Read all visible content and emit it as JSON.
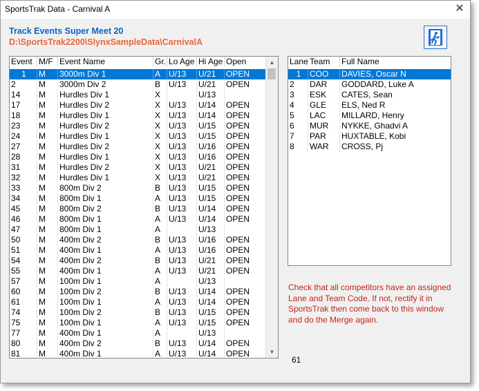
{
  "window": {
    "title": "SportsTrak Data - Carnival A",
    "close_glyph": "✕"
  },
  "header": {
    "title": "Track Events  Super Meet 20",
    "path": "D:\\SportsTrak2200\\SlynxSampleData\\CarnivalA",
    "title_color": "#0a64c8",
    "path_color": "#e8663c"
  },
  "run_button": {
    "icon": "running-man-exit-icon"
  },
  "events": {
    "headers": [
      "Event",
      "M/F",
      "Event Name",
      "Gr.",
      "Lo Age",
      "Hi Age",
      "Open"
    ],
    "selected_index": 0,
    "rows": [
      [
        "1",
        "M",
        "3000m Div 1",
        "A",
        "U/13",
        "U/21",
        "OPEN"
      ],
      [
        "2",
        "M",
        "3000m Div 2",
        "B",
        "U/13",
        "U/21",
        "OPEN"
      ],
      [
        "14",
        "M",
        "Hurdles Div 1",
        "X",
        "",
        "U/13",
        ""
      ],
      [
        "17",
        "M",
        "Hurdles Div 2",
        "X",
        "U/13",
        "U/14",
        "OPEN"
      ],
      [
        "18",
        "M",
        "Hurdles Div 1",
        "X",
        "U/13",
        "U/14",
        "OPEN"
      ],
      [
        "23",
        "M",
        "Hurdles Div 2",
        "X",
        "U/13",
        "U/15",
        "OPEN"
      ],
      [
        "24",
        "M",
        "Hurdles Div 1",
        "X",
        "U/13",
        "U/15",
        "OPEN"
      ],
      [
        "27",
        "M",
        "Hurdles Div 2",
        "X",
        "U/13",
        "U/16",
        "OPEN"
      ],
      [
        "28",
        "M",
        "Hurdles Div 1",
        "X",
        "U/13",
        "U/16",
        "OPEN"
      ],
      [
        "31",
        "M",
        "Hurdles Div 2",
        "X",
        "U/13",
        "U/21",
        "OPEN"
      ],
      [
        "32",
        "M",
        "Hurdles Div 1",
        "X",
        "U/13",
        "U/21",
        "OPEN"
      ],
      [
        "33",
        "M",
        "800m Div 2",
        "B",
        "U/13",
        "U/15",
        "OPEN"
      ],
      [
        "34",
        "M",
        "800m Div 1",
        "A",
        "U/13",
        "U/15",
        "OPEN"
      ],
      [
        "45",
        "M",
        "800m Div 2",
        "B",
        "U/13",
        "U/14",
        "OPEN"
      ],
      [
        "46",
        "M",
        "800m Div 1",
        "A",
        "U/13",
        "U/14",
        "OPEN"
      ],
      [
        "47",
        "M",
        "800m Div 1",
        "A",
        "",
        "U/13",
        ""
      ],
      [
        "50",
        "M",
        "400m Div 2",
        "B",
        "U/13",
        "U/16",
        "OPEN"
      ],
      [
        "51",
        "M",
        "400m Div 1",
        "A",
        "U/13",
        "U/16",
        "OPEN"
      ],
      [
        "54",
        "M",
        "400m Div 2",
        "B",
        "U/13",
        "U/21",
        "OPEN"
      ],
      [
        "55",
        "M",
        "400m Div 1",
        "A",
        "U/13",
        "U/21",
        "OPEN"
      ],
      [
        "57",
        "M",
        "100m Div 1",
        "A",
        "",
        "U/13",
        ""
      ],
      [
        "60",
        "M",
        "100m Div 2",
        "B",
        "U/13",
        "U/14",
        "OPEN"
      ],
      [
        "61",
        "M",
        "100m Div 1",
        "A",
        "U/13",
        "U/14",
        "OPEN"
      ],
      [
        "74",
        "M",
        "100m Div 2",
        "B",
        "U/13",
        "U/15",
        "OPEN"
      ],
      [
        "75",
        "M",
        "100m Div 1",
        "A",
        "U/13",
        "U/15",
        "OPEN"
      ],
      [
        "77",
        "M",
        "400m Div 1",
        "A",
        "",
        "U/13",
        ""
      ],
      [
        "80",
        "M",
        "400m Div 2",
        "B",
        "U/13",
        "U/14",
        "OPEN"
      ],
      [
        "81",
        "M",
        "400m Div 1",
        "A",
        "U/13",
        "U/14",
        "OPEN"
      ]
    ]
  },
  "lanes": {
    "headers": [
      "Lane",
      "Team",
      "Full Name"
    ],
    "selected_index": 0,
    "rows": [
      [
        "1",
        "COO",
        "DAVIES, Oscar N"
      ],
      [
        "2",
        "DAR",
        "GODDARD, Luke A"
      ],
      [
        "3",
        "ESK",
        "CATES, Sean"
      ],
      [
        "4",
        "GLE",
        "ELS, Ned R"
      ],
      [
        "5",
        "LAC",
        "MILLARD, Henry"
      ],
      [
        "6",
        "MUR",
        "NYKKE, Ghadvi A"
      ],
      [
        "7",
        "PAR",
        "HUXTABLE, Kobi"
      ],
      [
        "8",
        "WAR",
        "CROSS, Pj"
      ]
    ]
  },
  "message": "Check that all competitors have an assigned Lane and Team Code.  If not, rectify it in SportsTrak then come back to this window and do the Merge again.",
  "count": "61",
  "colors": {
    "selection": "#0078d7",
    "message": "#c0261e",
    "button_border": "#2a6fd6"
  }
}
